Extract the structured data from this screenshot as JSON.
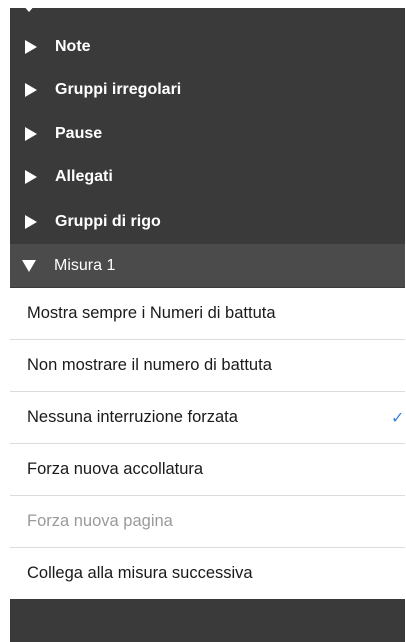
{
  "collapsed_sections": [
    {
      "label": "Note"
    },
    {
      "label": "Gruppi irregolari"
    },
    {
      "label": "Pause"
    },
    {
      "label": "Allegati"
    },
    {
      "label": "Gruppi di rigo"
    }
  ],
  "expanded_section": {
    "label": "Misura 1"
  },
  "options": [
    {
      "label": "Mostra sempre i Numeri di battuta",
      "selected": false,
      "disabled": false
    },
    {
      "label": "Non mostrare il numero di battuta",
      "selected": false,
      "disabled": false
    },
    {
      "label": "Nessuna interruzione forzata",
      "selected": true,
      "disabled": false
    },
    {
      "label": "Forza nuova accollatura",
      "selected": false,
      "disabled": false
    },
    {
      "label": "Forza nuova pagina",
      "selected": false,
      "disabled": true
    },
    {
      "label": "Collega alla misura successiva",
      "selected": false,
      "disabled": false
    }
  ],
  "icons": {
    "collapsed": "triangle-right-icon",
    "expanded": "triangle-down-icon",
    "selected": "checkmark-icon"
  },
  "colors": {
    "panel_bg": "#3a3a3a",
    "expanded_bg": "#4b4b4b",
    "check": "#3a83d8",
    "disabled_text": "#9a9a9a"
  }
}
